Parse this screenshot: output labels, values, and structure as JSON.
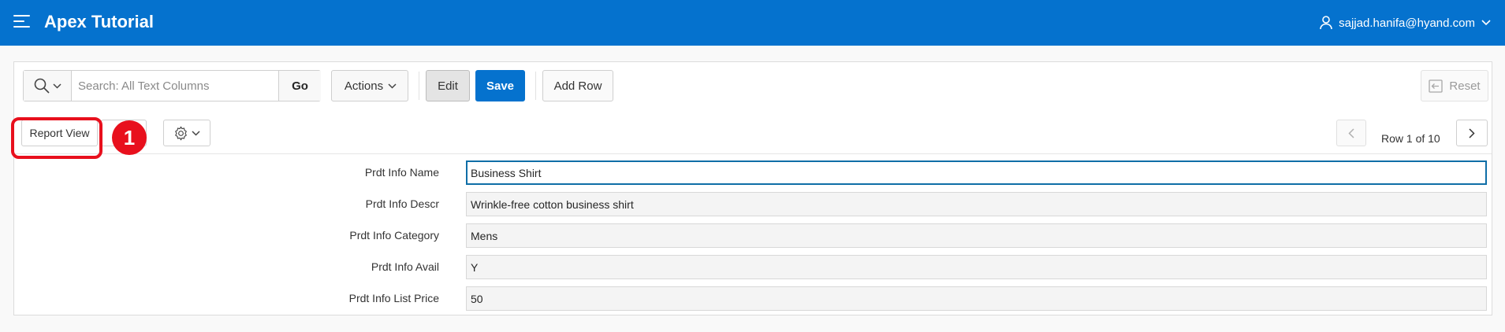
{
  "header": {
    "app_title": "Apex Tutorial",
    "user": "sajjad.hanifa@hyand.com"
  },
  "toolbar": {
    "search_placeholder": "Search: All Text Columns",
    "search_value": "",
    "go_label": "Go",
    "actions_label": "Actions",
    "edit_label": "Edit",
    "save_label": "Save",
    "add_row_label": "Add Row",
    "reset_label": "Reset"
  },
  "view_bar": {
    "report_view_label": "Report View",
    "callout_number": "1",
    "row_counter": "Row 1 of 10"
  },
  "form": {
    "fields": [
      {
        "label": "Prdt Info Name",
        "value": "Business Shirt",
        "active": true
      },
      {
        "label": "Prdt Info Descr",
        "value": "Wrinkle-free cotton business shirt",
        "active": false
      },
      {
        "label": "Prdt Info Category",
        "value": "Mens",
        "active": false
      },
      {
        "label": "Prdt Info Avail",
        "value": "Y",
        "active": false
      },
      {
        "label": "Prdt Info List Price",
        "value": "50",
        "active": false
      }
    ]
  },
  "colors": {
    "header_bg": "#0572ce",
    "save_bg": "#0572ce",
    "callout": "#e8101d",
    "active_field_border": "#0f6ea7"
  },
  "icons": [
    "menu-icon",
    "user-icon",
    "chevron-down-icon",
    "search-icon",
    "gear-icon",
    "reset-icon",
    "chevron-left-icon",
    "chevron-right-icon"
  ]
}
